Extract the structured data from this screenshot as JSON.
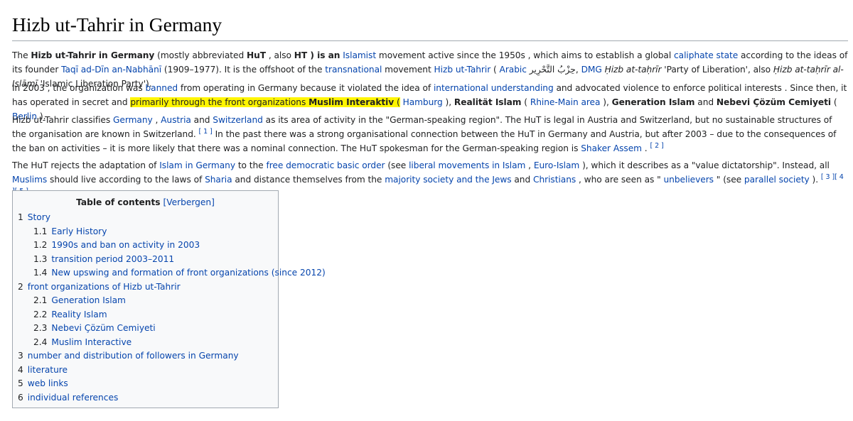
{
  "title": "Hizb ut-Tahrir in Germany",
  "p1": {
    "t1": "The ",
    "b1": "Hizb ut-Tahrir in Germany",
    "t2": " (mostly abbreviated ",
    "b2": "HuT",
    "t3": " , also ",
    "b3": "HT ) is an",
    "t4": " ",
    "l1": "Islamist",
    "t5": " movement active since the 1950s , which aims to establish a global ",
    "l2": "caliphate state",
    "t6": " according to the ideas of its founder ",
    "l3": "Taqī ad-Dīn an-Nabhānī",
    "t7": " (1909–1977). It is the offshoot of the ",
    "l4": "transnational",
    "t8": " movement ",
    "l5": "Hizb ut-Tahrir",
    "t9": " ( ",
    "l6": "Arabic",
    "t10": " حِزْبُ التَّحْرِير, ",
    "l7": "DMG",
    "t11": " ",
    "i1": "Ḥizb at-taḥrīr",
    "t12": " 'Party of Liberation', also ",
    "i2": "Ḥizb at-taḥrīr al-Islāmī",
    "t13": " 'Islamic Liberation Party')."
  },
  "p2": {
    "t1": "In 2003 , the organization was ",
    "l1": "banned",
    "t2": " from operating in Germany because it violated the idea of ",
    "l2": "international understanding",
    "t3": " and advocated violence to enforce political interests . Since then, it has operated in secret and ",
    "h1": "primarily through the front organizations ",
    "h2": "Muslim Interaktiv",
    "h3": " (",
    "t4": " ",
    "l3": "Hamburg",
    "t5": " ), ",
    "b1": "Realität Islam",
    "t6": " ( ",
    "l4": "Rhine-Main area",
    "t7": " ), ",
    "b2": "Generation Islam",
    "t8": " and ",
    "b3": "Nebevi Çözüm Cemiyeti",
    "t9": " ( ",
    "l5": "Berlin",
    "t10": " )."
  },
  "p3": {
    "t1": "Hizb ut-Tahrir classifies ",
    "l1": "Germany",
    "t2": " , ",
    "l2": "Austria",
    "t3": " and ",
    "l3": "Switzerland",
    "t4": " as its area of activity in the \"German-speaking region\". The HuT is legal in Austria and Switzerland, but no sustainable structures of the organisation are known in Switzerland. ",
    "r1": "[ 1 ]",
    "t5": " In the past there was a strong organisational connection between the HuT in Germany and Austria, but after 2003 – due to the consequences of the ban on activities – it is more likely that there was a nominal connection. The HuT spokesman for the German-speaking region is ",
    "l4": "Shaker Assem",
    "t6": " . ",
    "r2": "[ 2 ]"
  },
  "p4": {
    "t1": "The HuT rejects the adaptation of ",
    "l1": "Islam in Germany",
    "t2": " to the ",
    "l2": "free democratic basic order",
    "t3": " (see ",
    "l3": "liberal movements in Islam",
    "t4": " , ",
    "l4": "Euro-Islam",
    "t5": " ), which it describes as a \"value dictatorship\". Instead, all ",
    "l5": "Muslims",
    "t6": " should live according to the laws of ",
    "l6": "Sharia",
    "t7": " and distance themselves from the ",
    "l7": "majority society and the Jews",
    "t8": " and ",
    "l8": "Christians",
    "t9": " , who are seen as \" ",
    "l9": "unbelievers",
    "t10": " \" (see ",
    "l10": "parallel society",
    "t11": " ). ",
    "r1": "[ 3 ]",
    "r2": "[ 4 ]",
    "r3": "[ 5 ]"
  },
  "toc": {
    "title": "Table of contents",
    "toggle": "[Verbergen]",
    "items": [
      {
        "num": "1",
        "label": "Story"
      },
      {
        "num": "1.1",
        "label": "Early History"
      },
      {
        "num": "1.2",
        "label": "1990s and ban on activity in 2003"
      },
      {
        "num": "1.3",
        "label": "transition period 2003–2011"
      },
      {
        "num": "1.4",
        "label": "New upswing and formation of front organizations (since 2012)"
      },
      {
        "num": "2",
        "label": "front organizations of Hizb ut-Tahrir"
      },
      {
        "num": "2.1",
        "label": "Generation Islam"
      },
      {
        "num": "2.2",
        "label": "Reality Islam"
      },
      {
        "num": "2.3",
        "label": "Nebevi Çözüm Cemiyeti"
      },
      {
        "num": "2.4",
        "label": "Muslim Interactive"
      },
      {
        "num": "3",
        "label": "number and distribution of followers in Germany"
      },
      {
        "num": "4",
        "label": "literature"
      },
      {
        "num": "5",
        "label": "web links"
      },
      {
        "num": "6",
        "label": "individual references"
      }
    ]
  },
  "colors": {
    "link": "#0645ad",
    "highlight": "#fff500",
    "toc_bg": "#f8f9fa",
    "border": "#a2a9b1"
  }
}
